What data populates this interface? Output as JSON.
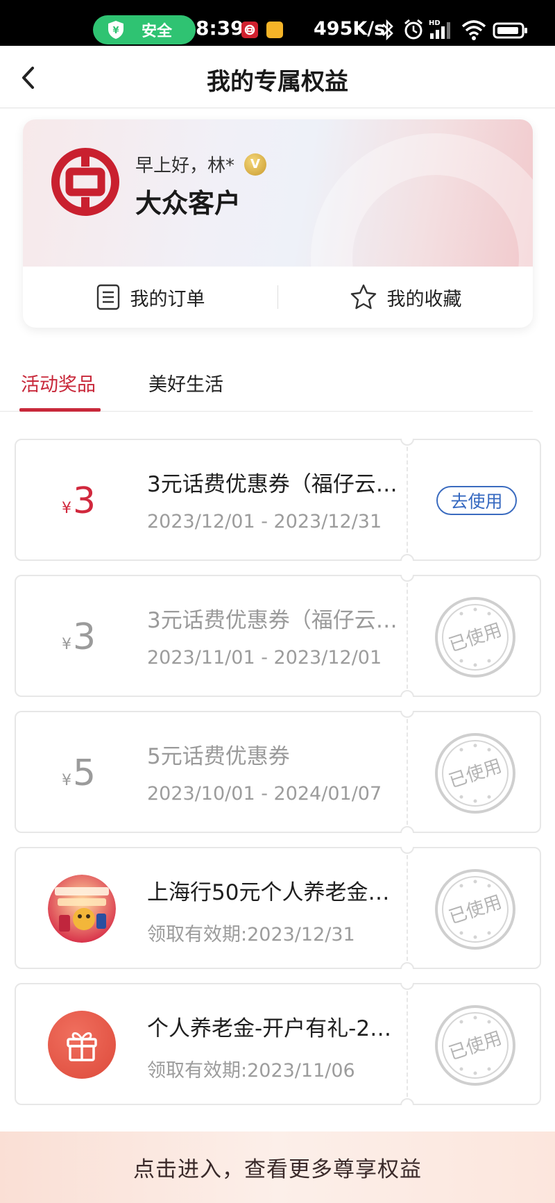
{
  "status_bar": {
    "security_label": "安全",
    "time": "8:39",
    "network_speed": "495K/s"
  },
  "header": {
    "title": "我的专属权益"
  },
  "member_card": {
    "greeting": "早上好，林*",
    "badge_letter": "V",
    "level": "大众客户",
    "orders_label": "我的订单",
    "favorites_label": "我的收藏"
  },
  "tabs": [
    {
      "label": "活动奖品",
      "active": true
    },
    {
      "label": "美好生活",
      "active": false
    }
  ],
  "coupons": [
    {
      "currency": "¥",
      "amount": "3",
      "title": "3元话费优惠券（福仔云…",
      "period": "2023/12/01 - 2023/12/31",
      "action": "去使用",
      "used": false
    },
    {
      "currency": "¥",
      "amount": "3",
      "title": "3元话费优惠券（福仔云…",
      "period": "2023/11/01 - 2023/12/01",
      "status": "已使用",
      "used": true
    },
    {
      "currency": "¥",
      "amount": "5",
      "title": "5元话费优惠券",
      "period": "2023/10/01 - 2024/01/07",
      "status": "已使用",
      "used": true
    },
    {
      "title": "上海行50元个人养老金…",
      "period": "领取有效期:2023/12/31",
      "status": "已使用",
      "used": true,
      "icon": "promo-thumbnail"
    },
    {
      "title": "个人养老金-开户有礼-2…",
      "period": "领取有效期:2023/11/06",
      "status": "已使用",
      "used": true,
      "icon": "gift-icon"
    }
  ],
  "banner": {
    "text": "点击进入，查看更多尊享权益"
  },
  "colors": {
    "brand_red": "#c8283a",
    "link_blue": "#3568c0",
    "security_green": "#2fc372"
  }
}
